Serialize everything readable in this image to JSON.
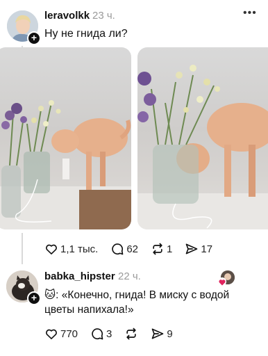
{
  "post": {
    "username": "leravolkk",
    "time": "23 ч.",
    "text": "Ну не гнида ли?",
    "likes": "1,1 тыс.",
    "comments": "62",
    "reposts": "1",
    "shares": "17"
  },
  "reply": {
    "username": "babka_hipster",
    "time": "22 ч.",
    "emoji": "🐱",
    "text": ": «Конечно, гнида! В миску с водой цветы напихала!»",
    "likes": "770",
    "comments": "3",
    "shares": "9"
  },
  "icons": {
    "more": "more-dots-icon",
    "like": "heart-icon",
    "comment": "speech-bubble-icon",
    "repost": "repost-arrows-icon",
    "share": "send-arrow-icon"
  },
  "colors": {
    "text": "#101010",
    "muted": "#9a9a9a",
    "heart_accent": "#e0245e"
  }
}
